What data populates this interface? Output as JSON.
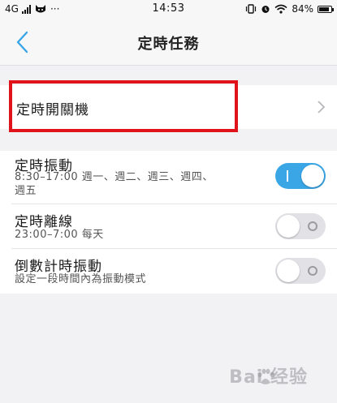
{
  "status_bar": {
    "network": "4G",
    "dots": "···",
    "time": "14:53",
    "battery_percent": "84%",
    "battery_level": 0.84
  },
  "nav": {
    "title": "定時任務"
  },
  "rows": {
    "power_schedule": {
      "title": "定時開關機"
    },
    "vibrate": {
      "title": "定時振動",
      "subtitle_line1": "8:30–17:00 週一、週二、週三、週四、",
      "subtitle_line2": "週五",
      "enabled": true
    },
    "offline": {
      "title": "定時離線",
      "subtitle": "23:00–7:00 每天",
      "enabled": false
    },
    "countdown_vibrate": {
      "title": "倒數計時振動",
      "subtitle": "設定一段時間內為振動模式",
      "enabled": false
    }
  },
  "watermark": {
    "text": "Bai 经验"
  },
  "colors": {
    "accent": "#3aa6e6",
    "highlight": "#e0131a",
    "background": "#f2f2f4"
  }
}
